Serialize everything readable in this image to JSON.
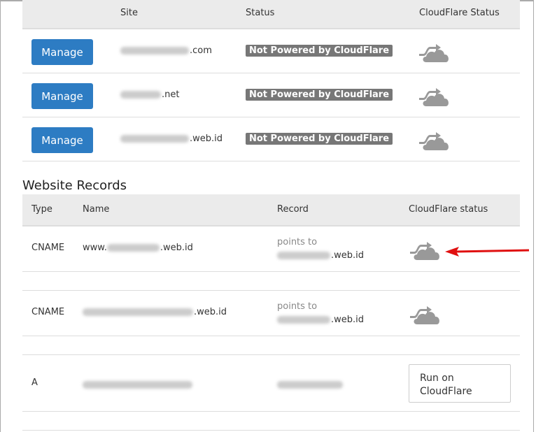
{
  "sites_table": {
    "headers": [
      "",
      "Site",
      "Status",
      "CloudFlare Status"
    ],
    "rows": [
      {
        "button": "Manage",
        "site_suffix": ".com",
        "status": "Not Powered by CloudFlare",
        "cf_icon": "cloud-off-icon"
      },
      {
        "button": "Manage",
        "site_suffix": ".net",
        "status": "Not Powered by CloudFlare",
        "cf_icon": "cloud-off-icon"
      },
      {
        "button": "Manage",
        "site_suffix": ".web.id",
        "status": "Not Powered by CloudFlare",
        "cf_icon": "cloud-off-icon"
      }
    ]
  },
  "records": {
    "title": "Website Records",
    "headers": [
      "Type",
      "Name",
      "Record",
      "CloudFlare status"
    ],
    "rows": [
      {
        "type": "CNAME",
        "name_prefix": "www.",
        "name_suffix": ".web.id",
        "record_line1": "points to",
        "record_suffix": ".web.id"
      },
      {
        "type": "CNAME",
        "name_prefix": "",
        "name_suffix": ".web.id",
        "record_line1": "points to",
        "record_suffix": ".web.id"
      },
      {
        "type": "A",
        "run_button": "Run on CloudFlare"
      }
    ]
  },
  "colors": {
    "manage_button": "#2d7cc3",
    "badge": "#777777",
    "annotation_arrow": "#e01010"
  }
}
